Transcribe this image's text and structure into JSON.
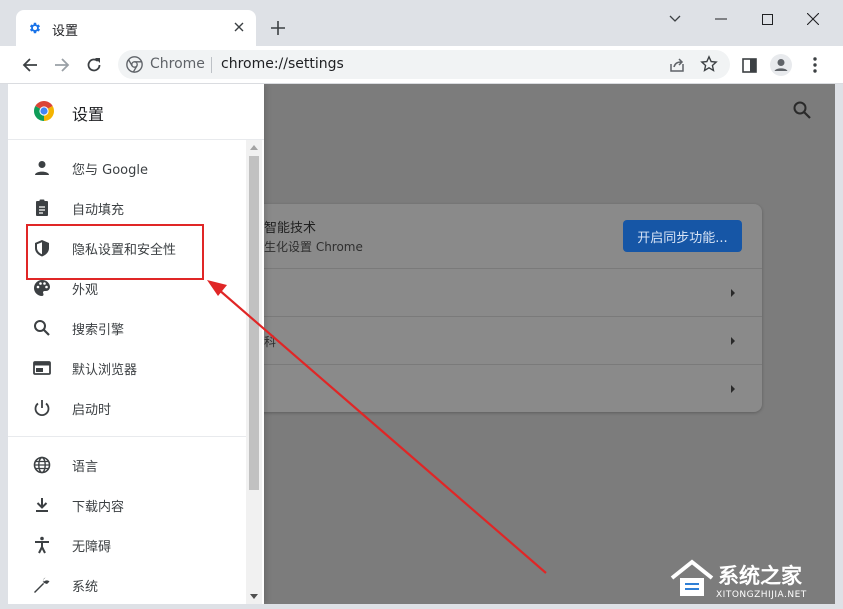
{
  "tab": {
    "title": "设置"
  },
  "toolbar": {
    "site_name": "Chrome",
    "url": "chrome://settings"
  },
  "drawer": {
    "title": "设置",
    "items": [
      {
        "label": "您与 Google",
        "icon": "person-icon"
      },
      {
        "label": "自动填充",
        "icon": "clipboard-icon"
      },
      {
        "label": "隐私设置和安全性",
        "icon": "shield-icon"
      },
      {
        "label": "外观",
        "icon": "palette-icon"
      },
      {
        "label": "搜索引擎",
        "icon": "search-icon"
      },
      {
        "label": "默认浏览器",
        "icon": "browser-window-icon"
      },
      {
        "label": "启动时",
        "icon": "power-icon"
      },
      {
        "label": "语言",
        "icon": "globe-icon"
      },
      {
        "label": "下载内容",
        "icon": "download-icon"
      },
      {
        "label": "无障碍",
        "icon": "accessibility-icon"
      },
      {
        "label": "系统",
        "icon": "wrench-icon"
      }
    ]
  },
  "main": {
    "card": {
      "line1": "智能技术",
      "line2": "生化设置 Chrome",
      "sync_button": "开启同步功能...",
      "row2_text": "科"
    }
  },
  "watermark": {
    "title": "系统之家",
    "url": "XITONGZHIJIA.NET"
  },
  "colors": {
    "accent_blue": "#1a73e8",
    "annotation_red": "#e02626",
    "dim_overlay": "#7c7c7c"
  }
}
